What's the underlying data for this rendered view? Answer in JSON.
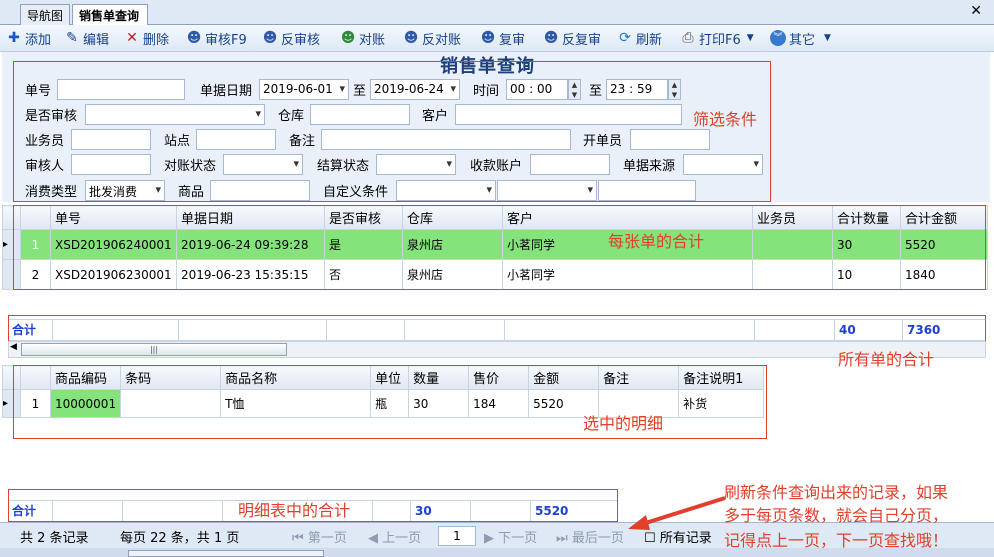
{
  "tabs": {
    "nav": "导航图",
    "sales": "销售单查询",
    "close": "✕"
  },
  "toolbar": {
    "add": "添加",
    "edit": "编辑",
    "delete": "删除",
    "audit": "审核F9",
    "unaudit": "反审核",
    "reconcile": "对账",
    "unreconcile": "反对账",
    "review": "复审",
    "unreview": "反复审",
    "refresh": "刷新",
    "print": "打印F6",
    "other": "其它"
  },
  "form": {
    "title": "销售单查询",
    "order_no_label": "单号",
    "date_label": "单据日期",
    "date_from": "2019-06-01",
    "to": "至",
    "date_to": "2019-06-24",
    "time_label": "时间",
    "time_from": "00 : 00",
    "time_to": "23 : 59",
    "audited_label": "是否审核",
    "warehouse_label": "仓库",
    "customer_label": "客户",
    "salesman_label": "业务员",
    "site_label": "站点",
    "remark_label": "备注",
    "creator_label": "开单员",
    "auditor_label": "审核人",
    "recon_status_label": "对账状态",
    "settle_status_label": "结算状态",
    "account_label": "收款账户",
    "source_label": "单据来源",
    "consume_type_label": "消费类型",
    "consume_type_value": "批发消费",
    "product_label": "商品",
    "custom_cond_label": "自定义条件"
  },
  "annotations": {
    "filter": "筛选条件",
    "per_order_total": "每张单的合计",
    "all_total": "所有单的合计",
    "selected_detail": "选中的明细",
    "detail_total": "明细表中的合计",
    "pager_note_1": "刷新条件查询出来的记录，如果",
    "pager_note_2": "多于每页条数，就会自己分页，",
    "pager_note_3": "记得点上一页，下一页查找哦！"
  },
  "orders": {
    "columns": [
      "单号",
      "单据日期",
      "是否审核",
      "仓库",
      "客户",
      "业务员",
      "合计数量",
      "合计金额"
    ],
    "rows": [
      {
        "idx": "1",
        "no": "XSD201906240001",
        "date": "2019-06-24 09:39:28",
        "audited": "是",
        "warehouse": "泉州店",
        "customer": "小茗同学",
        "salesman": "",
        "qty": "30",
        "amount": "5520"
      },
      {
        "idx": "2",
        "no": "XSD201906230001",
        "date": "2019-06-23 15:35:15",
        "audited": "否",
        "warehouse": "泉州店",
        "customer": "小茗同学",
        "salesman": "",
        "qty": "10",
        "amount": "1840"
      }
    ],
    "total_label": "合计",
    "total_qty": "40",
    "total_amount": "7360",
    "scroll_grip": "|||"
  },
  "details": {
    "columns": [
      "商品编码",
      "条码",
      "商品名称",
      "单位",
      "数量",
      "售价",
      "金额",
      "备注",
      "备注说明1"
    ],
    "rows": [
      {
        "idx": "1",
        "code": "10000001",
        "barcode": "",
        "name": "T恤",
        "unit": "瓶",
        "qty": "30",
        "price": "184",
        "amount": "5520",
        "remark": "",
        "remark1": "补货"
      }
    ],
    "total_label": "合计",
    "total_qty": "30",
    "total_amount": "5520"
  },
  "pager": {
    "records": "共 2 条记录",
    "per_page": "每页 22 条，共 1 页",
    "first": "第一页",
    "prev": "上一页",
    "page": "1",
    "next": "下一页",
    "last": "最后一页",
    "all_records": "所有记录"
  },
  "colors": {
    "accent": "#15428b",
    "annotation": "#e0402c",
    "selected_row": "#84e37a",
    "totals": "#1f3fd1"
  }
}
